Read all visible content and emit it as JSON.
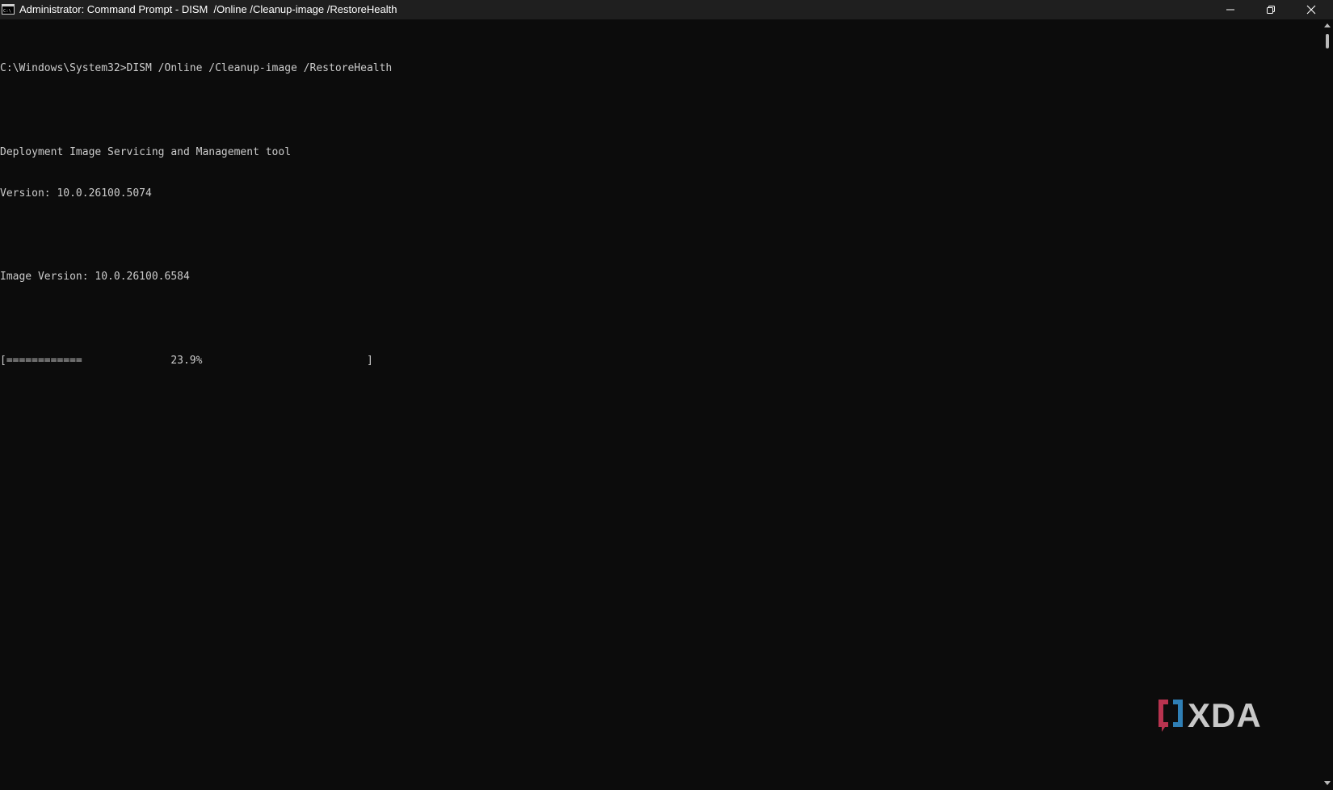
{
  "window": {
    "title": "Administrator: Command Prompt - DISM  /Online /Cleanup-image /RestoreHealth",
    "app_icon": "cmd-icon",
    "controls": [
      "minimize-icon",
      "restore-icon",
      "close-icon"
    ]
  },
  "console": {
    "lines": [
      "C:\\Windows\\System32>DISM /Online /Cleanup-image /RestoreHealth",
      "",
      "Deployment Image Servicing and Management tool",
      "Version: 10.0.26100.5074",
      "",
      "Image Version: 10.0.26100.6584",
      "",
      "[============              23.9%                          ]"
    ],
    "progress": 23.9
  },
  "watermark": {
    "text": "XDA",
    "colors": {
      "bracket_left": "#b8334f",
      "bracket_right": "#2f7fb5",
      "text": "#c8c8c8"
    }
  },
  "colors": {
    "background": "#0c0c0c",
    "titlebar": "#1f1f1f",
    "text": "#cccccc"
  }
}
